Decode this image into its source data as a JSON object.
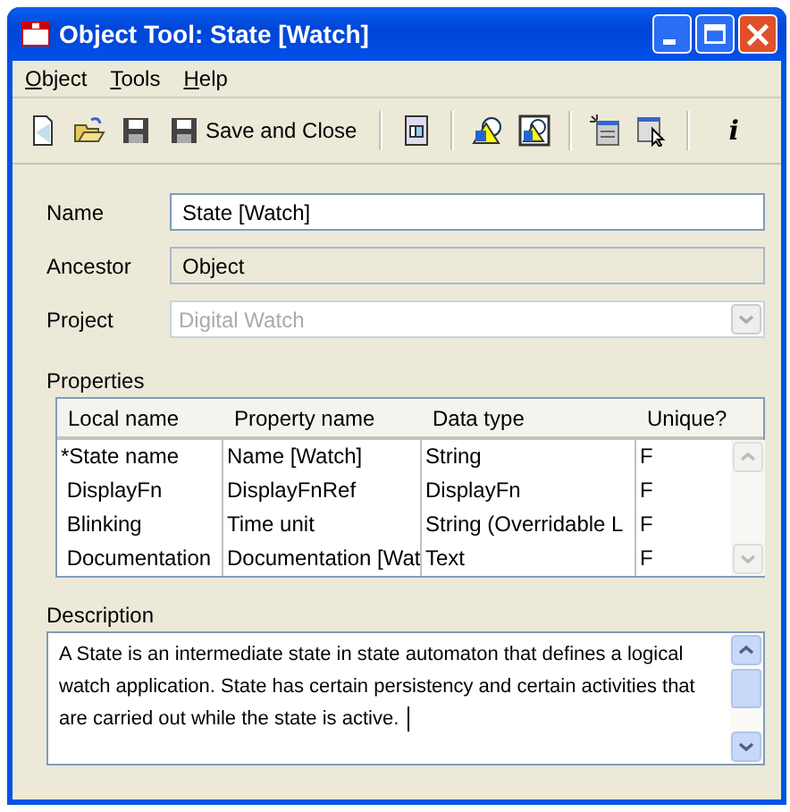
{
  "window": {
    "title": "Object Tool: State [Watch]"
  },
  "menu": [
    "Object",
    "Tools",
    "Help"
  ],
  "toolbar": [
    {
      "kind": "icon"
    },
    {
      "kind": "icon"
    },
    {
      "kind": "icon"
    },
    {
      "kind": "button",
      "label": "Save and Close"
    },
    {
      "kind": "separator"
    },
    {
      "kind": "icon"
    },
    {
      "kind": "separator"
    },
    {
      "kind": "icon"
    },
    {
      "kind": "icon"
    },
    {
      "kind": "separator"
    },
    {
      "kind": "icon"
    },
    {
      "kind": "icon"
    },
    {
      "kind": "separator"
    },
    {
      "kind": "glyph",
      "label": "i"
    }
  ],
  "fields": [
    {
      "label": "Name",
      "value": "State [Watch]",
      "kind": "text",
      "readonly": false,
      "disabled": false
    },
    {
      "label": "Ancestor",
      "value": "Object",
      "kind": "text",
      "readonly": true,
      "disabled": false
    },
    {
      "label": "Project",
      "value": "Digital Watch",
      "kind": "combo",
      "readonly": false,
      "disabled": true
    }
  ],
  "properties": {
    "title": "Properties",
    "columns": [
      "Local name",
      "Property name",
      "Data type",
      "Unique?"
    ],
    "rows": [
      [
        "*State name",
        "Name [Watch]",
        "String",
        "F"
      ],
      [
        " DisplayFn",
        "DisplayFnRef",
        "DisplayFn",
        "F"
      ],
      [
        " Blinking",
        "Time unit",
        "String (Overridable L",
        "F"
      ],
      [
        " Documentation",
        "Documentation [Wat",
        "Text",
        "F"
      ]
    ]
  },
  "description": {
    "title": "Description",
    "value": "A State is an intermediate state in state automaton that defines a logical watch application. State has certain persistency and certain activities that are carried out while the state is active."
  }
}
